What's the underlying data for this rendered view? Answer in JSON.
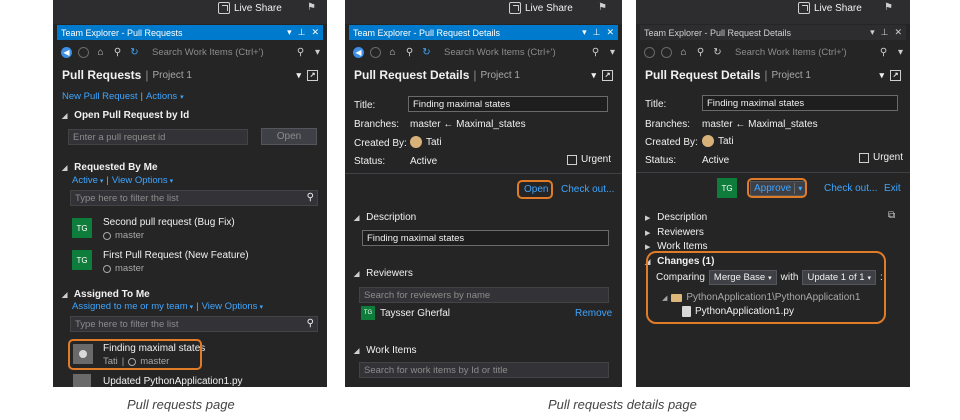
{
  "common": {
    "live_share": "Live Share",
    "search_placeholder": "Search Work Items (Ctrl+')",
    "project": "Project 1"
  },
  "panel1": {
    "window_title": "Team Explorer - Pull Requests",
    "header_title": "Pull Requests",
    "new_pr_link": "New Pull Request",
    "actions_link": "Actions",
    "open_by_id_section": "Open Pull Request by Id",
    "id_placeholder": "Enter a pull request id",
    "open_button": "Open",
    "requested_section": "Requested By Me",
    "active_filter": "Active",
    "view_options": "View Options",
    "filter_placeholder": "Type here to filter the list",
    "requested_items": [
      {
        "initials": "TG",
        "title": "Second pull request (Bug Fix)",
        "branch": "master"
      },
      {
        "initials": "TG",
        "title": "First Pull Request (New Feature)",
        "branch": "master"
      }
    ],
    "assigned_section": "Assigned To Me",
    "assigned_filter": "Assigned to me or my team",
    "assigned_view_options": "View Options",
    "assigned_filter_placeholder": "Type here to filter the list",
    "assigned_items": [
      {
        "title": "Finding maximal states",
        "author": "Tati",
        "branch": "master"
      },
      {
        "title": "Updated PythonApplication1.py"
      }
    ]
  },
  "panel2": {
    "window_title": "Team Explorer - Pull Request Details",
    "header_title": "Pull Request Details",
    "title_label": "Title:",
    "title_value": "Finding maximal states",
    "branches_label": "Branches:",
    "branches_value": "master ← Maximal_states",
    "created_by_label": "Created By:",
    "created_by_value": "Tati",
    "status_label": "Status:",
    "status_value": "Active",
    "urgent_label": "Urgent",
    "open_link": "Open",
    "checkout_link": "Check out...",
    "description_section": "Description",
    "description_value": "Finding maximal states",
    "reviewers_section": "Reviewers",
    "reviewers_placeholder": "Search for reviewers by name",
    "reviewer_initials": "TG",
    "reviewer_name": "Taysser Gherfal",
    "remove_link": "Remove",
    "work_items_section": "Work Items",
    "work_items_placeholder": "Search for work items by Id or title"
  },
  "panel3": {
    "window_title": "Team Explorer - Pull Request Details",
    "header_title": "Pull Request Details",
    "title_label": "Title:",
    "title_value": "Finding maximal states",
    "branches_label": "Branches:",
    "branches_value": "master ← Maximal_states",
    "created_by_label": "Created By:",
    "created_by_value": "Tati",
    "status_label": "Status:",
    "status_value": "Active",
    "urgent_label": "Urgent",
    "avatar_initials": "TG",
    "approve_button": "Approve",
    "checkout_link": "Check out...",
    "exit_link": "Exit",
    "description_section": "Description",
    "reviewers_section": "Reviewers",
    "work_items_section": "Work Items",
    "changes_section": "Changes (1)",
    "comparing_label": "Comparing",
    "merge_base": "Merge Base",
    "with_label": "with",
    "update_combo": "Update 1 of 1",
    "folder_path": "PythonApplication1\\PythonApplication1",
    "file_name": "PythonApplication1.py"
  },
  "captions": {
    "left": "Pull requests page",
    "right": "Pull requests details page"
  },
  "colors": {
    "accent": "#007acc",
    "highlight": "#e07b28",
    "link": "#3ea6ff",
    "avatar": "#0e7c3a"
  }
}
